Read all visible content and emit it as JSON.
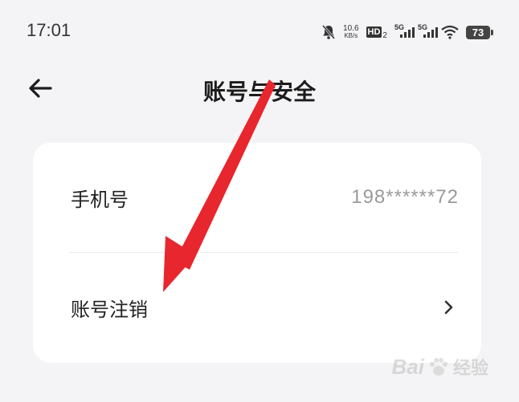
{
  "status_bar": {
    "time": "17:01",
    "speed_value": "10.6",
    "speed_unit": "KB/s",
    "hd_label": "HD",
    "hd_sub": "2",
    "sim1": "5G",
    "sim2": "5G",
    "battery": "73",
    "icons": [
      "bell-muted-icon",
      "hd-icon",
      "signal-5g-icon",
      "signal-5g-icon",
      "wifi-icon",
      "battery-icon"
    ]
  },
  "header": {
    "title": "账号与安全",
    "back_icon": "back-arrow-icon"
  },
  "settings": {
    "rows": [
      {
        "label": "手机号",
        "value": "198******72"
      },
      {
        "label": "账号注销",
        "icon": "chevron-right-icon"
      }
    ]
  },
  "annotation": {
    "color": "#e8262e",
    "icon": "red-pointer-arrow"
  },
  "watermark": {
    "brand": "Bai",
    "suffix": "经验"
  },
  "colors": {
    "background": "#f4f4f6",
    "card": "#ffffff",
    "value_text": "#9a9a9a",
    "arrow": "#e8262e"
  }
}
